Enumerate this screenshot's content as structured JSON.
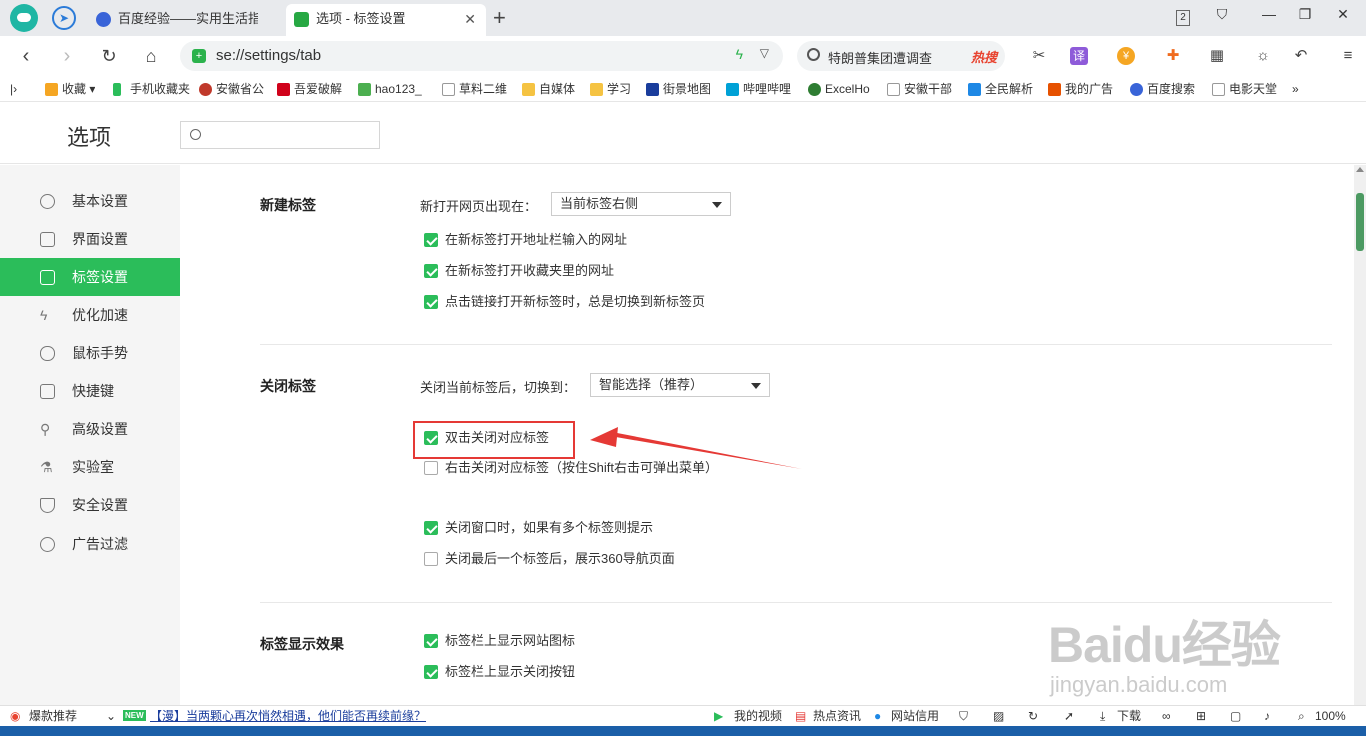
{
  "tabs": [
    {
      "title": "百度经验——实用生活指南",
      "active": false
    },
    {
      "title": "选项 - 标签设置",
      "active": true
    }
  ],
  "window": {
    "tab_count": "2"
  },
  "address": {
    "url": "se://settings/tab"
  },
  "search": {
    "query": "特朗普集团遭调查",
    "badge": "热搜"
  },
  "bookmarks": [
    {
      "label": "收藏",
      "color": "#f5a623"
    },
    {
      "label": "手机收藏夹",
      "color": "#2bbd5a"
    },
    {
      "label": "安徽省公",
      "color": "#c0392b"
    },
    {
      "label": "吾爱破解",
      "color": "#d0021b"
    },
    {
      "label": "hao123_",
      "color": "#4caf50"
    },
    {
      "label": "草料二维",
      "color": "#999999"
    },
    {
      "label": "自媒体",
      "color": "#f5c342"
    },
    {
      "label": "学习",
      "color": "#f5c342"
    },
    {
      "label": "街景地图",
      "color": "#1a3d9c"
    },
    {
      "label": "哔哩哔哩",
      "color": "#00a1d6"
    },
    {
      "label": "ExcelHo",
      "color": "#2e7d32"
    },
    {
      "label": "安徽干部",
      "color": "#999999"
    },
    {
      "label": "全民解析",
      "color": "#1e88e5"
    },
    {
      "label": "我的广告",
      "color": "#e65100"
    },
    {
      "label": "百度搜索",
      "color": "#3964d8"
    },
    {
      "label": "电影天堂",
      "color": "#999999"
    },
    {
      "label": "»",
      "color": "#ffffff"
    }
  ],
  "settings": {
    "title": "选项",
    "search_placeholder": ""
  },
  "sidebar": {
    "items": [
      {
        "label": "基本设置",
        "icon": "gear-icon"
      },
      {
        "label": "界面设置",
        "icon": "window-icon"
      },
      {
        "label": "标签设置",
        "icon": "tab-icon"
      },
      {
        "label": "优化加速",
        "icon": "lightning-icon"
      },
      {
        "label": "鼠标手势",
        "icon": "mouse-icon"
      },
      {
        "label": "快捷键",
        "icon": "keyboard-icon"
      },
      {
        "label": "高级设置",
        "icon": "wrench-icon"
      },
      {
        "label": "实验室",
        "icon": "flask-icon"
      },
      {
        "label": "安全设置",
        "icon": "shield-icon"
      },
      {
        "label": "广告过滤",
        "icon": "block-icon"
      }
    ]
  },
  "sections": {
    "new_tab": {
      "title": "新建标签",
      "open_label": "新打开网页出现在：",
      "open_value": "当前标签右侧",
      "options": [
        {
          "label": "在新标签打开地址栏输入的网址",
          "checked": true
        },
        {
          "label": "在新标签打开收藏夹里的网址",
          "checked": true
        },
        {
          "label": "点击链接打开新标签时，总是切换到新标签页",
          "checked": true
        }
      ]
    },
    "close_tab": {
      "title": "关闭标签",
      "switch_label": "关闭当前标签后，切换到：",
      "switch_value": "智能选择（推荐）",
      "options": [
        {
          "label": "双击关闭对应标签",
          "checked": true
        },
        {
          "label": "右击关闭对应标签（按住Shift右击可弹出菜单）",
          "checked": false
        },
        {
          "label": "关闭窗口时，如果有多个标签则提示",
          "checked": true
        },
        {
          "label": "关闭最后一个标签后，展示360导航页面",
          "checked": false
        }
      ]
    },
    "display": {
      "title": "标签显示效果",
      "options": [
        {
          "label": "标签栏上显示网站图标",
          "checked": true
        },
        {
          "label": "标签栏上显示关闭按钮",
          "checked": true
        }
      ]
    }
  },
  "statusbar": {
    "hot": "爆款推荐",
    "new_badge": "NEW",
    "news": "【漫】当两颗心再次悄然相遇，他们能否再续前缘？",
    "video": "我的视频",
    "info": "热点资讯",
    "credit": "网站信用",
    "download": "下载",
    "zoom": "100%"
  },
  "watermark": {
    "logo": "Baidu经验",
    "url": "jingyan.baidu.com"
  }
}
